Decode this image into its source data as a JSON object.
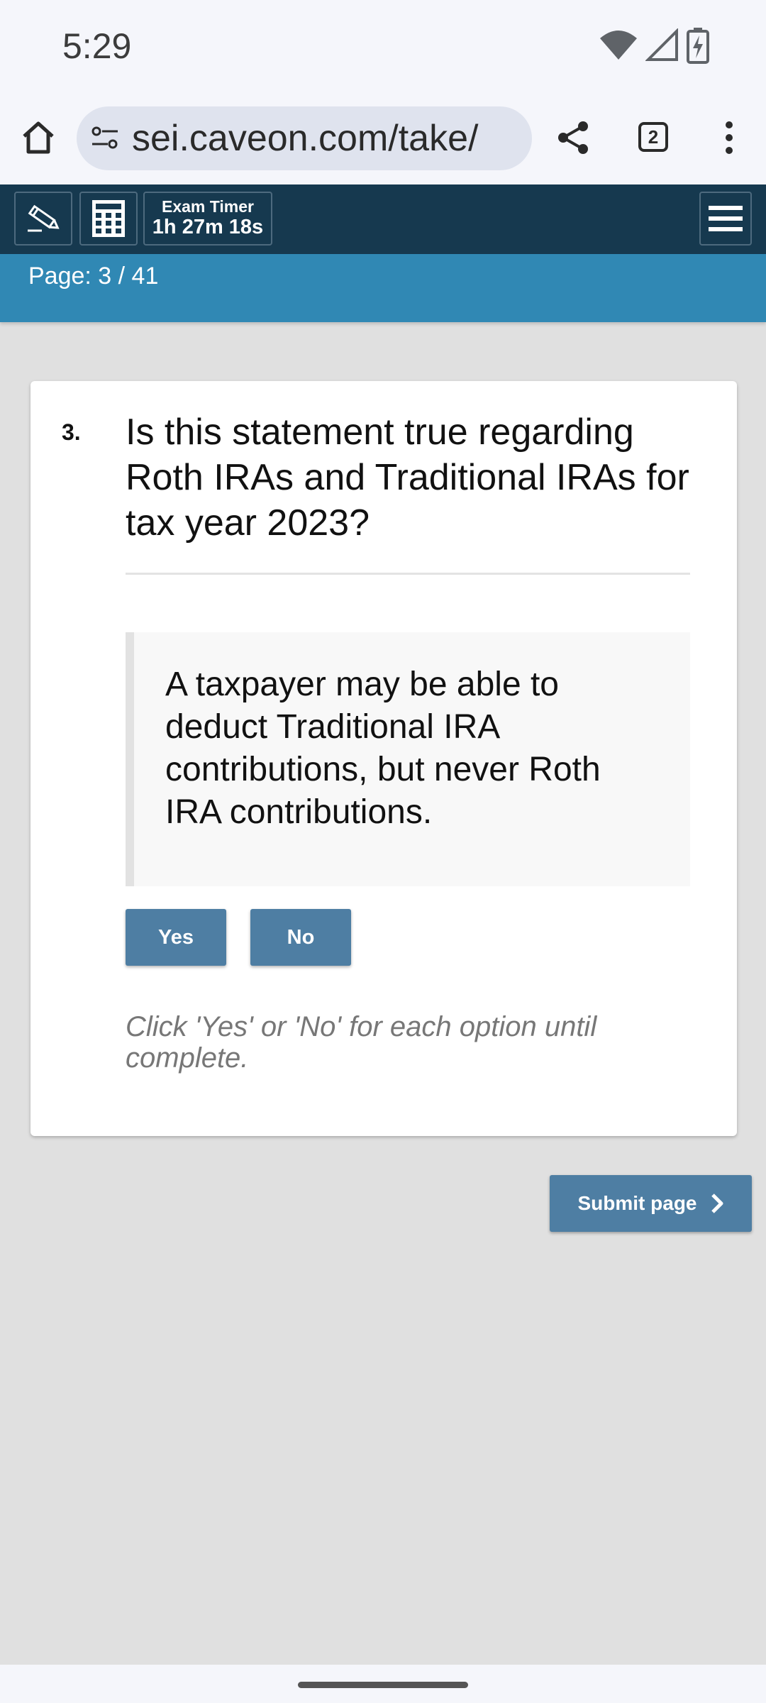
{
  "status_bar": {
    "time": "5:29",
    "icons": [
      "wifi-icon",
      "cell-signal-icon",
      "battery-charging-icon"
    ]
  },
  "browser": {
    "url": "sei.caveon.com/take/",
    "tab_count": "2",
    "icons": [
      "home-icon",
      "site-settings-icon",
      "share-icon",
      "tabs-icon",
      "more-vert-icon"
    ]
  },
  "exam_toolbar": {
    "timer_label": "Exam Timer",
    "timer_value": "1h 27m 18s",
    "icons": [
      "pencil-icon",
      "calculator-icon",
      "hamburger-menu-icon"
    ]
  },
  "page_indicator": {
    "label": "Page: 3 / 41"
  },
  "question": {
    "number": "3.",
    "text": "Is this statement true regarding Roth IRAs and Traditional IRAs for tax year 2023?",
    "statement": "A taxpayer may be able to deduct Traditional IRA contributions, but never Roth IRA contributions.",
    "yes_label": "Yes",
    "no_label": "No",
    "instruction": "Click 'Yes' or 'No' for each option until complete."
  },
  "footer": {
    "submit_label": "Submit page"
  },
  "colors": {
    "toolbar_bg": "#16394f",
    "page_bar_bg": "#3088b4",
    "button_bg": "#4e7ea3",
    "page_bg": "#e0e0e0"
  }
}
